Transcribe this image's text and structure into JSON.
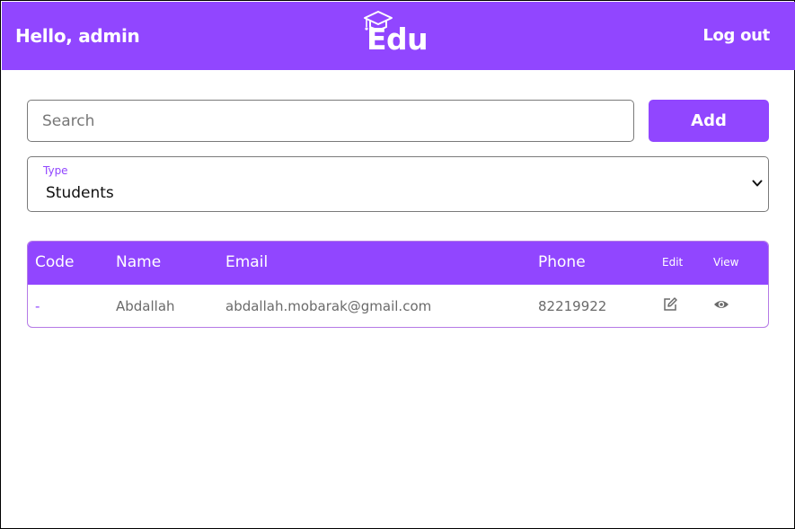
{
  "header": {
    "greeting": "Hello, admin",
    "logo_text": "Edu",
    "logout_label": "Log out",
    "background_color": "#9146ff"
  },
  "search": {
    "placeholder": "Search",
    "value": ""
  },
  "add_button": {
    "label": "Add"
  },
  "type_select": {
    "label": "Type",
    "selected": "Students"
  },
  "table": {
    "headers": [
      "Code",
      "Name",
      "Email",
      "Phone",
      "Edit",
      "View"
    ],
    "rows": [
      {
        "code": "-",
        "name": "Abdallah",
        "email": "abdallah.mobarak@gmail.com",
        "phone": "82219922",
        "edit_icon": "edit-icon",
        "view_icon": "eye-icon"
      }
    ]
  },
  "colors": {
    "accent": "#9146ff"
  }
}
